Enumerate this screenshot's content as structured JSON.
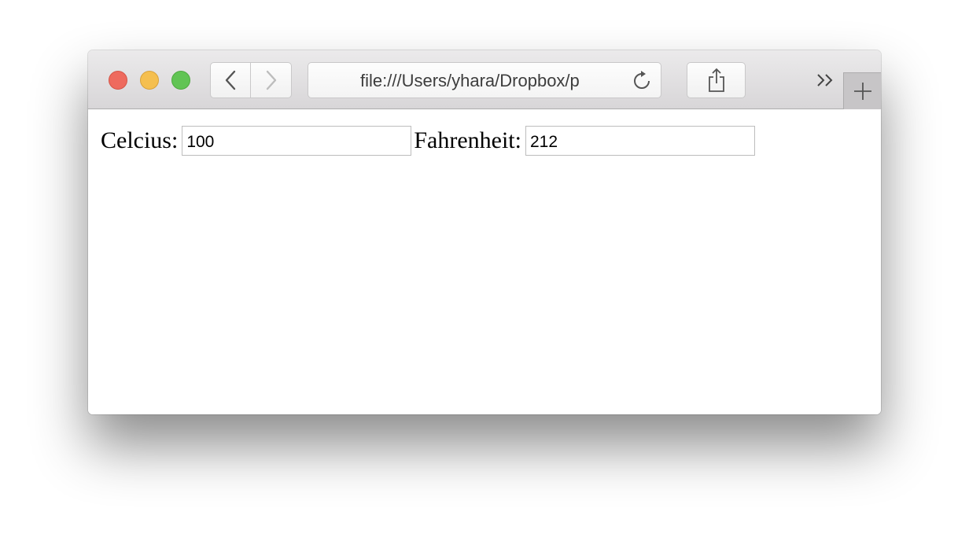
{
  "browser": {
    "url": "file:///Users/yhara/Dropbox/p",
    "icons": {
      "close": "close-light",
      "minimize": "minimize-light",
      "maximize": "maximize-light",
      "back": "chevron-left-icon",
      "forward": "chevron-right-icon",
      "reload": "reload-icon",
      "share": "share-icon",
      "overflow": "double-chevron-right-icon",
      "new_tab": "plus-icon"
    },
    "colors": {
      "close": "#ee6a5e",
      "minimize": "#f5bf4f",
      "maximize": "#61c454"
    }
  },
  "form": {
    "celsius_label": "Celcius:",
    "celsius_value": "100",
    "fahrenheit_label": "Fahrenheit:",
    "fahrenheit_value": "212"
  }
}
